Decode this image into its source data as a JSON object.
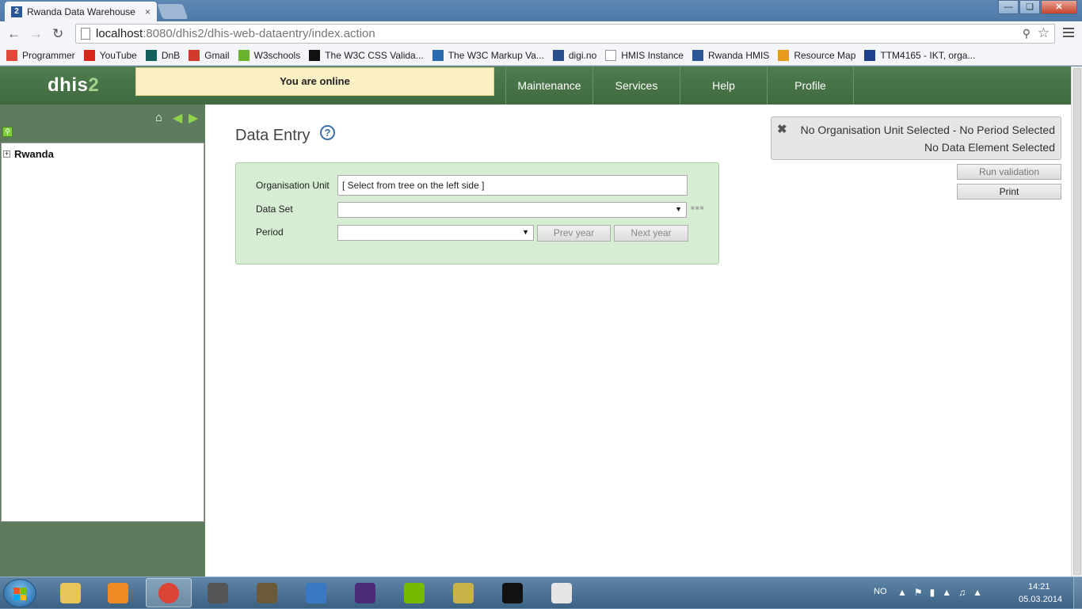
{
  "browser": {
    "tab_title": "Rwanda Data Warehouse",
    "tab_favicon": "2",
    "tab_close": "×",
    "url_host": "localhost",
    "url_path": ":8080/dhis2/dhis-web-dataentry/index.action"
  },
  "bookmarks": [
    {
      "label": "Programmer",
      "icon": "apps-grid-icon",
      "color": "#e04a3a"
    },
    {
      "label": "YouTube",
      "icon": "youtube-icon",
      "color": "#d8261c"
    },
    {
      "label": "DnB",
      "icon": "dnb-icon",
      "color": "#12605e"
    },
    {
      "label": "Gmail",
      "icon": "gmail-icon",
      "color": "#d33a2c"
    },
    {
      "label": "W3schools",
      "icon": "w3schools-icon",
      "color": "#6ab32f"
    },
    {
      "label": "The W3C CSS Valida...",
      "icon": "w3c-css-icon",
      "color": "#111111"
    },
    {
      "label": "The W3C Markup Va...",
      "icon": "w3c-markup-icon",
      "color": "#2a6ab0"
    },
    {
      "label": "digi.no",
      "icon": "digi-icon",
      "color": "#2b4f8c"
    },
    {
      "label": "HMIS Instance",
      "icon": "page-icon",
      "color": "#ffffff"
    },
    {
      "label": "Rwanda HMIS",
      "icon": "dhis2-icon",
      "color": "#2b5797"
    },
    {
      "label": "Resource Map",
      "icon": "map-pin-icon",
      "color": "#e89a1a"
    },
    {
      "label": "TTM4165 - IKT, orga...",
      "icon": "ntnu-icon",
      "color": "#1d3f8c"
    }
  ],
  "header": {
    "logo_text": "dhis",
    "logo_num": "2",
    "online_status": "You are online",
    "menu": [
      "Maintenance",
      "Services",
      "Help",
      "Profile"
    ]
  },
  "tree": {
    "root_label": "Rwanda",
    "expand_symbol": "+"
  },
  "main": {
    "title": "Data Entry",
    "help_symbol": "?",
    "form": {
      "orgunit_label": "Organisation Unit",
      "orgunit_value": "[ Select from tree on the left side ]",
      "dataset_label": "Data Set",
      "period_label": "Period",
      "prev_year": "Prev year",
      "next_year": "Next year"
    },
    "status": {
      "line1": "No Organisation Unit Selected - No Period Selected",
      "line2": "No Data Element Selected"
    },
    "run_validation": "Run validation",
    "print": "Print"
  },
  "taskbar": {
    "apps": [
      "explorer-icon",
      "media-player-icon",
      "chrome-icon",
      "sublime-icon",
      "gimp-icon",
      "network-icon",
      "eclipse-icon",
      "nvidia-icon",
      "texmaker-icon",
      "cmd-icon",
      "java-icon"
    ],
    "language": "NO",
    "time": "14:21",
    "date": "05.03.2014"
  },
  "colors": {
    "header_green": "#4f7d4f",
    "sidebar_green": "#5e7b5e",
    "form_bg": "#d6ecd3",
    "online_bg": "#fbf1c5"
  }
}
